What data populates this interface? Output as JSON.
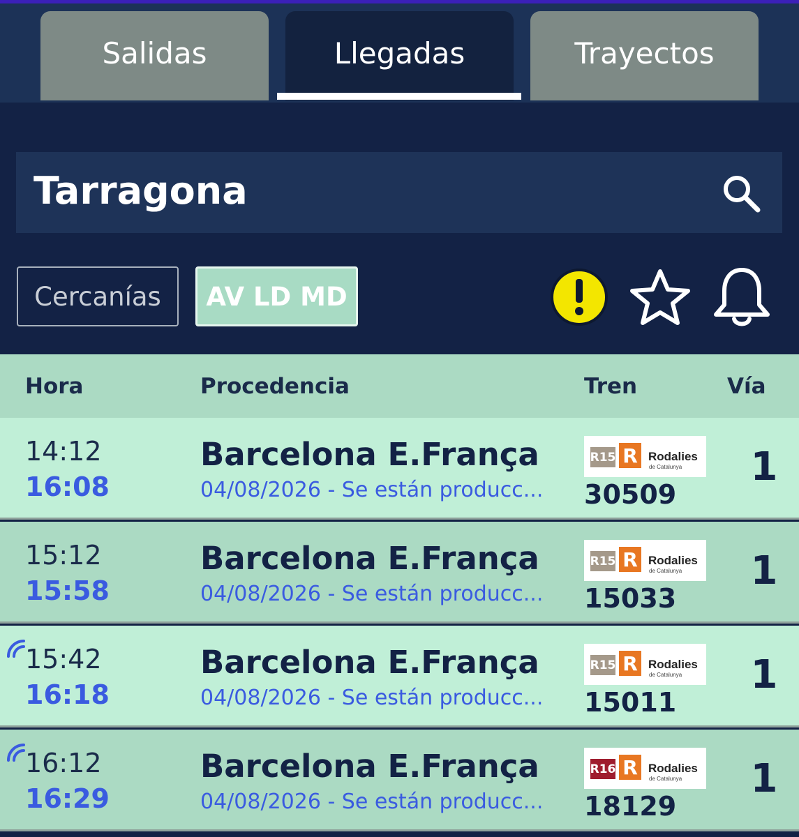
{
  "tabs": [
    {
      "label": "Salidas",
      "active": false
    },
    {
      "label": "Llegadas",
      "active": true
    },
    {
      "label": "Trayectos",
      "active": false
    }
  ],
  "search": {
    "station": "Tarragona",
    "icon": "search-icon"
  },
  "filters": [
    {
      "label": "Cercanías",
      "selected": false
    },
    {
      "label": "AV LD MD",
      "selected": true
    }
  ],
  "actions": {
    "alert_icon": "alert-icon",
    "favorite_icon": "star-icon",
    "notify_icon": "bell-icon"
  },
  "table": {
    "headers": {
      "time": "Hora",
      "origin": "Procedencia",
      "train": "Tren",
      "platform": "Vía"
    },
    "rows": [
      {
        "scheduled": "14:12",
        "real": "16:08",
        "live": false,
        "origin": "Barcelona E.França",
        "notice": "04/08/2026 - Se están producc...",
        "line": "R15",
        "brand": "Rodalies",
        "brand_sub": "de Catalunya",
        "train_no": "30509",
        "platform": "1"
      },
      {
        "scheduled": "15:12",
        "real": "15:58",
        "live": false,
        "origin": "Barcelona E.França",
        "notice": "04/08/2026 - Se están producc...",
        "line": "R15",
        "brand": "Rodalies",
        "brand_sub": "de Catalunya",
        "train_no": "15033",
        "platform": "1"
      },
      {
        "scheduled": "15:42",
        "real": "16:18",
        "live": true,
        "origin": "Barcelona E.França",
        "notice": "04/08/2026 - Se están producc...",
        "line": "R15",
        "brand": "Rodalies",
        "brand_sub": "de Catalunya",
        "train_no": "15011",
        "platform": "1"
      },
      {
        "scheduled": "16:12",
        "real": "16:29",
        "live": true,
        "origin": "Barcelona E.França",
        "notice": "04/08/2026 - Se están producc...",
        "line": "R16",
        "brand": "Rodalies",
        "brand_sub": "de Catalunya",
        "train_no": "18129",
        "platform": "1"
      }
    ]
  },
  "colors": {
    "header_bg": "#132245",
    "tab_inactive": "#7e8a86",
    "row_light": "#c0efd7",
    "row_dark": "#abdac3",
    "realtime_text": "#3a5be0",
    "alert_yellow": "#f3e600",
    "line_r15": "#a5998a",
    "line_r16": "#9f1c2e",
    "brand_orange": "#e87722"
  }
}
